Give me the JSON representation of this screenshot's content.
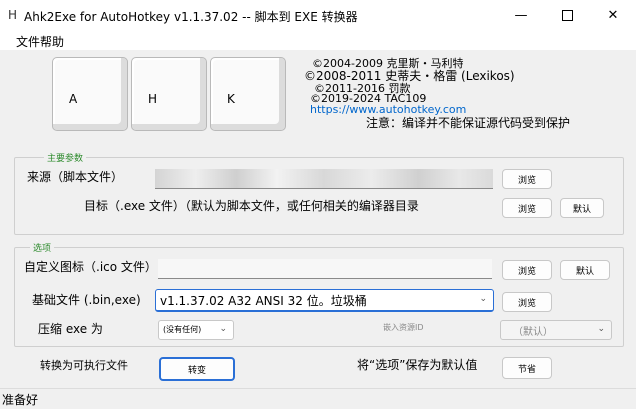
{
  "window": {
    "app_icon": "H",
    "title": "Ahk2Exe for AutoHotkey v1.1.37.02 -- 脚本到 EXE 转换器",
    "minimize_icon": "minimize-icon",
    "maximize_icon": "maximize-icon",
    "close_icon": "close-icon"
  },
  "menu": {
    "items": [
      "文件帮助"
    ]
  },
  "keys": [
    "A",
    "H",
    "K"
  ],
  "credits": {
    "line1": "©2004-2009 克里斯・马利特",
    "line2": "©2008-2011 史蒂夫・格雷 (Lexikos)",
    "line3": "©2011-2016 罚款",
    "line4": "©2019-2024 TAC109",
    "link": "https://www.autohotkey.com",
    "notice": "注意：编译并不能保证源代码受到保护"
  },
  "main_params": {
    "group_label": "主要参数",
    "source_label": "来源（脚本文件）",
    "source_value": "",
    "source_browse": "浏览",
    "target_label": "目标（.exe 文件）（默认为脚本文件，或任何相关的编译器目录",
    "target_value": "",
    "target_browse": "浏览",
    "target_default": "默认"
  },
  "options": {
    "group_label": "选项",
    "icon_label": "自定义图标（.ico 文件）",
    "icon_value": "",
    "icon_browse": "浏览",
    "icon_default": "默认",
    "base_label": "基础文件 (.bin,exe)",
    "base_value": "v1.1.37.02 A32 ANSI 32 位。垃圾桶",
    "base_browse": "浏览",
    "compress_label": "压缩 exe 为",
    "compress_value": "(没有任何)",
    "embed_label": "嵌入资源ID",
    "embed_value": "（默认）"
  },
  "bottom": {
    "convert_label": "转换为可执行文件",
    "convert_button": "转变",
    "save_label": "将“选项”保存为默认值",
    "save_button": "节省"
  },
  "status": {
    "text": "准备好"
  }
}
